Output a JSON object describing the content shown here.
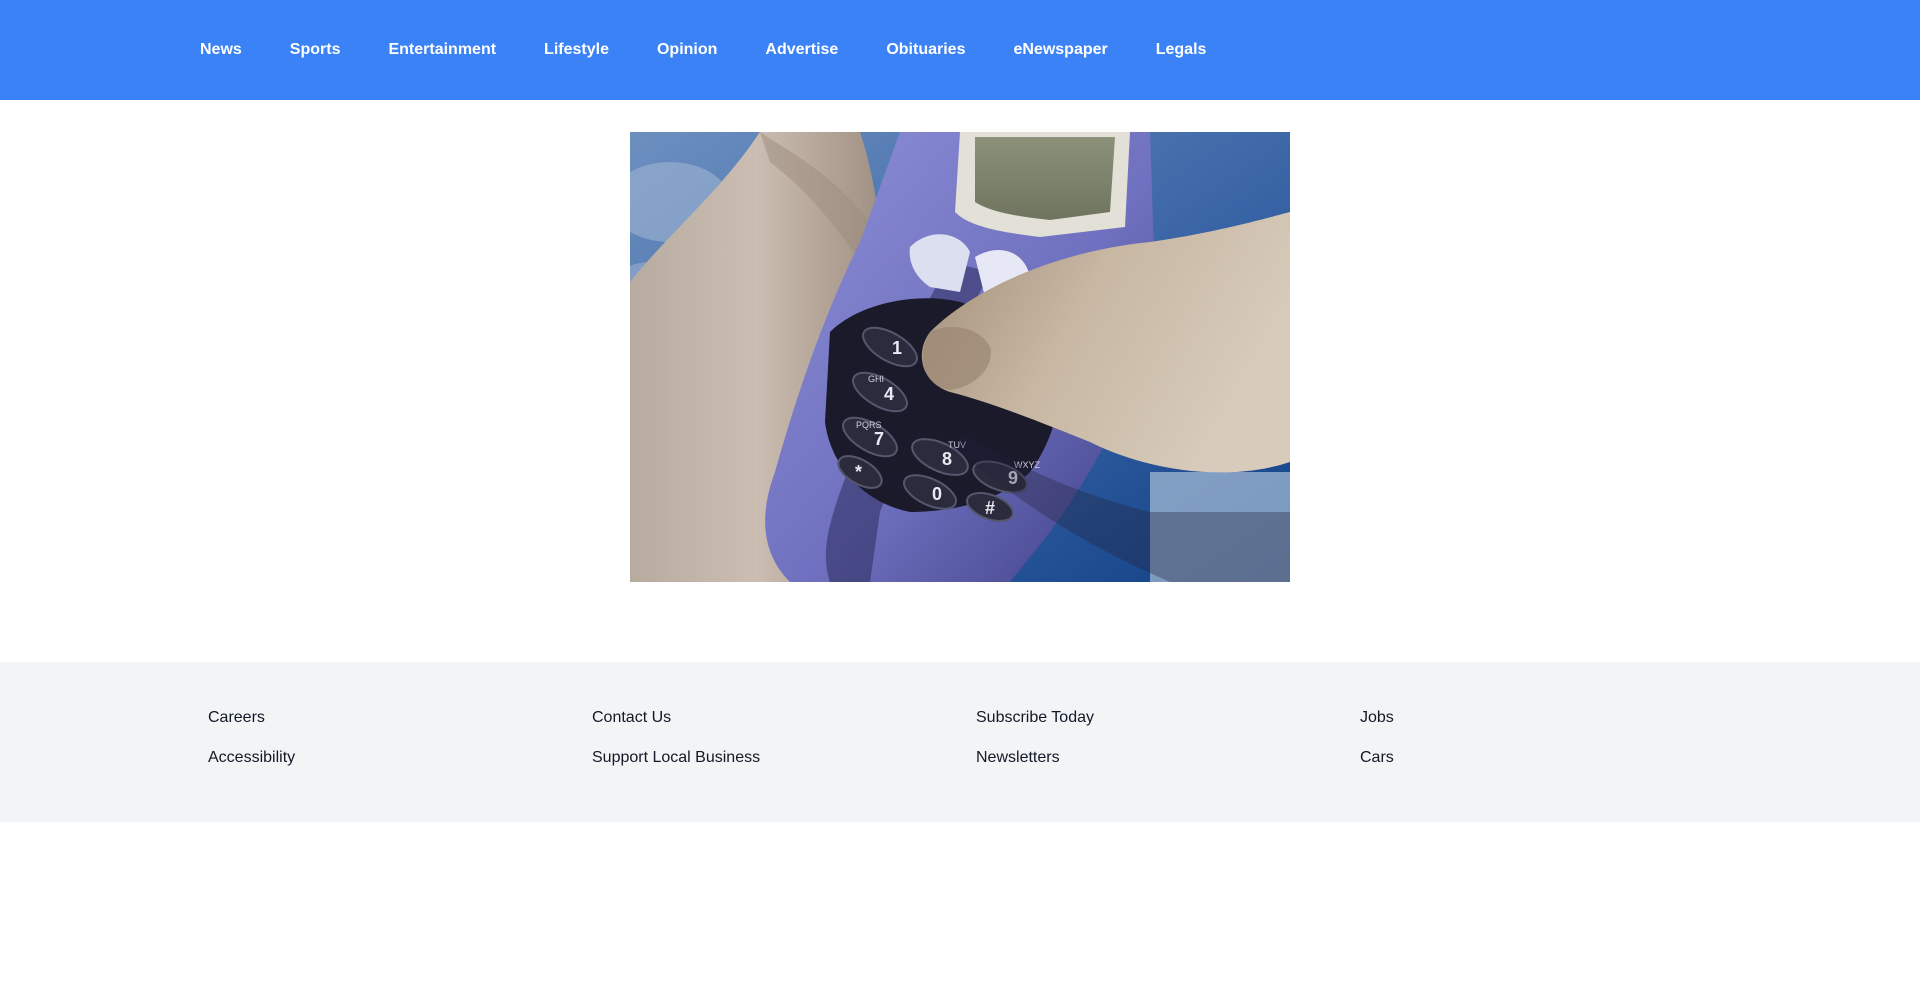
{
  "nav": {
    "items": [
      {
        "label": "News"
      },
      {
        "label": "Sports"
      },
      {
        "label": "Entertainment"
      },
      {
        "label": "Lifestyle"
      },
      {
        "label": "Opinion"
      },
      {
        "label": "Advertise"
      },
      {
        "label": "Obituaries"
      },
      {
        "label": "eNewspaper"
      },
      {
        "label": "Legals"
      }
    ]
  },
  "hero": {
    "phone_keys": [
      "1",
      "4",
      "7",
      "8",
      "0",
      "9",
      "*",
      "#"
    ],
    "phone_key_letters": [
      "GHI",
      "PQRS",
      "TUV",
      "WXYZ"
    ]
  },
  "footer": {
    "columns": [
      {
        "links": [
          {
            "label": "Careers"
          },
          {
            "label": "Accessibility"
          }
        ]
      },
      {
        "links": [
          {
            "label": "Contact Us"
          },
          {
            "label": "Support Local Business"
          }
        ]
      },
      {
        "links": [
          {
            "label": "Subscribe Today"
          },
          {
            "label": "Newsletters"
          }
        ]
      },
      {
        "links": [
          {
            "label": "Jobs"
          },
          {
            "label": "Cars"
          }
        ]
      }
    ]
  },
  "colors": {
    "nav_bg": "#3b82f6",
    "nav_text": "#ffffff",
    "footer_bg": "#f3f4f6",
    "footer_text": "#111827"
  }
}
